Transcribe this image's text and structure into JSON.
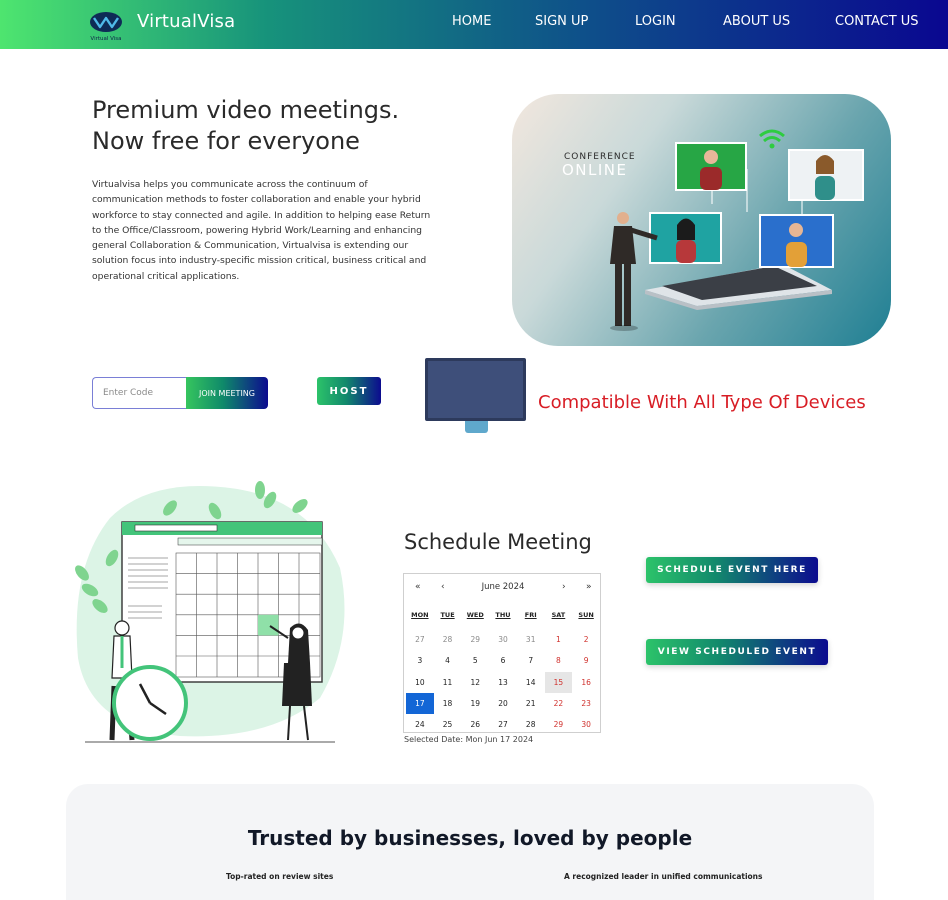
{
  "nav": {
    "brand": "VirtualVisa",
    "logo_caption": "Virtual Visa",
    "links": [
      "HOME",
      "SIGN UP",
      "LOGIN",
      "ABOUT US",
      "CONTACT US"
    ]
  },
  "hero": {
    "title_line1": "Premium video meetings.",
    "title_line2": "Now free for everyone",
    "description": "Virtualvisa helps you communicate across the continuum of communication methods to foster collaboration and enable your hybrid workforce to stay connected and agile. In addition to helping ease Return to the Office/Classroom, powering Hybrid Work/Learning and enhancing general Collaboration & Communication, Virtualvisa is extending our solution focus into industry-specific mission critical, business critical and operational critical applications.",
    "image_caption_top": "CONFERENCE",
    "image_caption_bottom": "ONLINE"
  },
  "join": {
    "code_placeholder": "Enter Code",
    "join_label": "JOIN MEETING",
    "host_label": "HOST"
  },
  "devices": {
    "text": "Compatible With All Type Of Devices"
  },
  "schedule": {
    "title": "Schedule Meeting",
    "calendar": {
      "month": "June 2024",
      "prev_year": "«",
      "prev_month": "‹",
      "next_month": "›",
      "next_year": "»",
      "weekdays": [
        "MON",
        "TUE",
        "WED",
        "THU",
        "FRI",
        "SAT",
        "SUN"
      ],
      "weeks": [
        [
          "27",
          "28",
          "29",
          "30",
          "31",
          "1",
          "2"
        ],
        [
          "3",
          "4",
          "5",
          "6",
          "7",
          "8",
          "9"
        ],
        [
          "10",
          "11",
          "12",
          "13",
          "14",
          "15",
          "16"
        ],
        [
          "17",
          "18",
          "19",
          "20",
          "21",
          "22",
          "23"
        ],
        [
          "24",
          "25",
          "26",
          "27",
          "28",
          "29",
          "30"
        ]
      ],
      "today": "15",
      "selected": "17"
    },
    "selected_text": "Selected Date: Mon Jun 17 2024",
    "schedule_button": "SCHEDULE EVENT HERE",
    "view_button": "VIEW SCHEDULED EVENT"
  },
  "trusted": {
    "title": "Trusted by businesses, loved by people",
    "left_sub": "Top-rated on review sites",
    "right_sub": "A recognized leader in unified communications"
  },
  "colors": {
    "nav_gradient_start": "#4ee56f",
    "nav_gradient_end": "#0a0790",
    "accent_red": "#d81d25",
    "selected_blue": "#1366d6"
  }
}
